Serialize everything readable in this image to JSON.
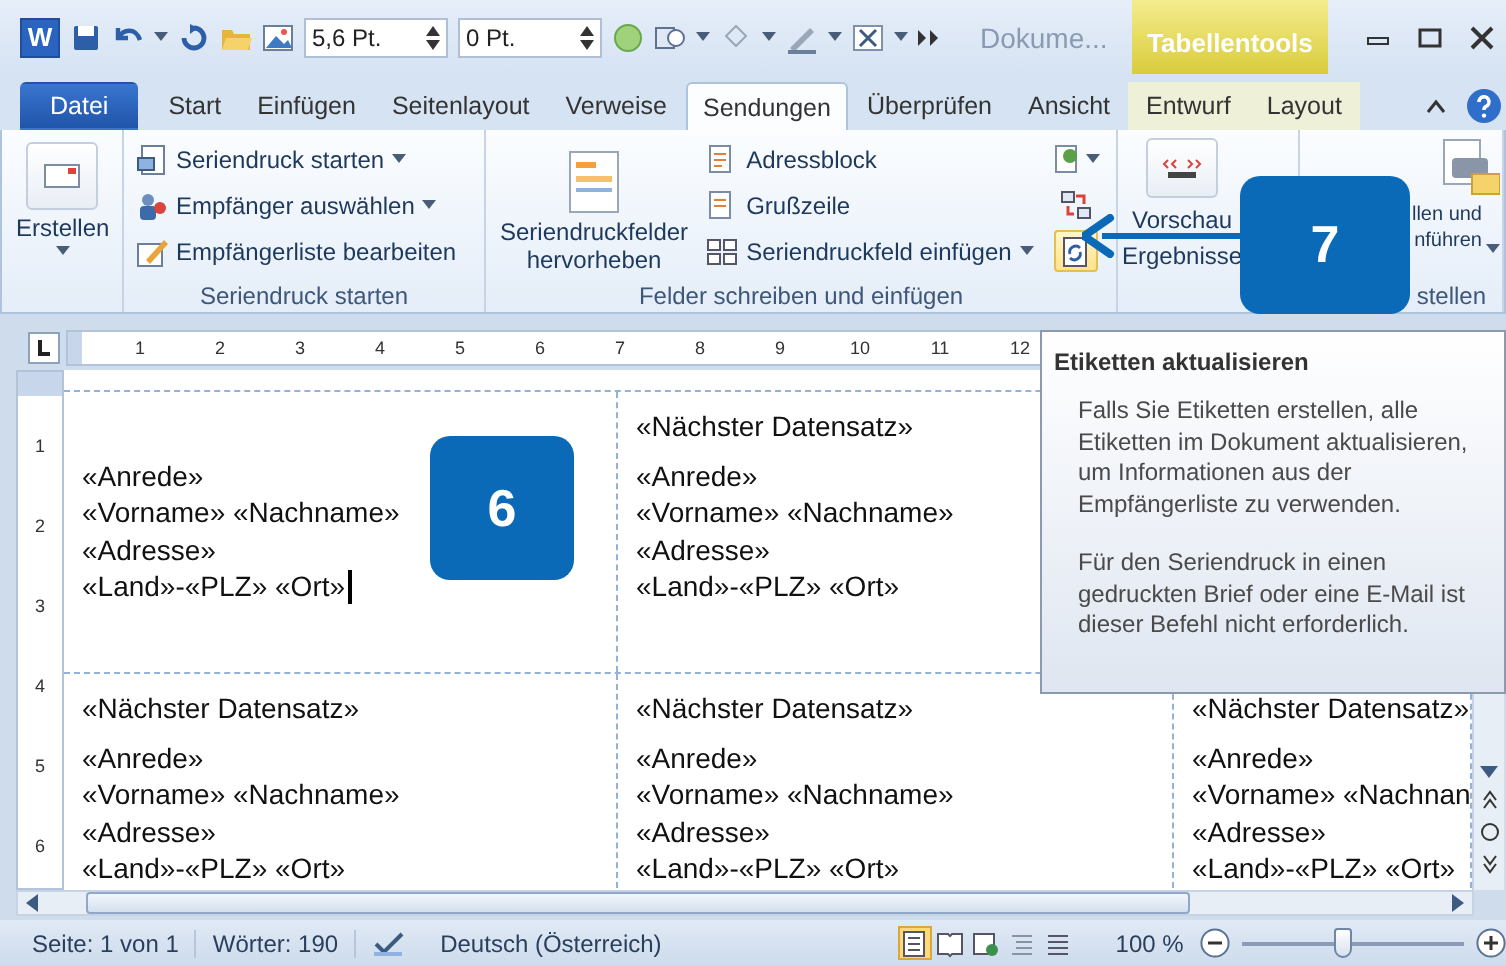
{
  "title_bar": {
    "app_letter": "W",
    "fields": [
      {
        "value": "5,6 Pt."
      },
      {
        "value": "0 Pt."
      }
    ],
    "document_title": "Dokume...",
    "context_title": "Tabellentools"
  },
  "tabs": [
    {
      "label": "Datei",
      "kind": "file",
      "selected": false
    },
    {
      "label": "Start",
      "kind": "normal",
      "selected": false
    },
    {
      "label": "Einfügen",
      "kind": "normal",
      "selected": false
    },
    {
      "label": "Seitenlayout",
      "kind": "normal",
      "selected": false
    },
    {
      "label": "Verweise",
      "kind": "normal",
      "selected": false
    },
    {
      "label": "Sendungen",
      "kind": "normal",
      "selected": true
    },
    {
      "label": "Überprüfen",
      "kind": "normal",
      "selected": false
    },
    {
      "label": "Ansicht",
      "kind": "normal",
      "selected": false
    },
    {
      "label": "Entwurf",
      "kind": "context",
      "selected": false
    },
    {
      "label": "Layout",
      "kind": "context",
      "selected": false
    }
  ],
  "ribbon": [
    {
      "kind": "create",
      "button": {
        "label": "Erstellen",
        "dropdown": true
      }
    },
    {
      "kind": "list",
      "label": "Seriendruck starten",
      "items": [
        {
          "label": "Seriendruck starten",
          "dropdown": true
        },
        {
          "label": "Empfänger auswählen",
          "dropdown": true
        },
        {
          "label": "Empfängerliste bearbeiten",
          "dropdown": false
        }
      ]
    },
    {
      "kind": "fields",
      "label": "Felder schreiben und einfügen",
      "big": {
        "label": "Seriendruckfelder\nhervorheben"
      },
      "items": [
        {
          "label": "Adressblock",
          "dropdown": false
        },
        {
          "label": "Grußzeile",
          "dropdown": false
        },
        {
          "label": "Seriendruckfeld einfügen",
          "dropdown": true
        }
      ],
      "tools": [
        {
          "dropdown": true,
          "highlighted": false
        },
        {
          "dropdown": false,
          "highlighted": false
        },
        {
          "dropdown": false,
          "highlighted": true
        }
      ]
    },
    {
      "kind": "preview",
      "big": {
        "label": "Vorschau\nErgebnisse"
      }
    },
    {
      "kind": "finish",
      "label": "stellen",
      "big": {
        "label": "llen und\nnführen",
        "dropdown": true
      }
    }
  ],
  "ruler": {
    "horizontal": [
      "1",
      "2",
      "3",
      "4",
      "5",
      "6",
      "7",
      "8",
      "9",
      "10",
      "11",
      "12"
    ],
    "vertical": [
      "1",
      "2",
      "3",
      "4",
      "5",
      "6"
    ]
  },
  "labels": [
    {
      "cells": [
        {
          "lines": [
            "«Anrede»",
            "«Vorname» «Nachname»",
            "«Adresse»",
            "«Land»-«PLZ» «Ort»"
          ],
          "caret": true
        },
        {
          "next_record": "«Nächster Datensatz»",
          "lines": [
            "«Anrede»",
            "«Vorname» «Nachname»",
            "«Adresse»",
            "«Land»-«PLZ» «Ort»"
          ],
          "caret": false
        }
      ]
    },
    {
      "cells": [
        {
          "next_record": "«Nächster Datensatz»",
          "lines": [
            "«Anrede»",
            "«Vorname» «Nachname»",
            "«Adresse»",
            "«Land»-«PLZ» «Ort»"
          ],
          "caret": false
        },
        {
          "next_record": "«Nächster Datensatz»",
          "lines": [
            "«Anrede»",
            "«Vorname» «Nachname»",
            "«Adresse»",
            "«Land»-«PLZ» «Ort»"
          ],
          "caret": false
        },
        {
          "next_record": "«Nächster Datensatz»",
          "lines": [
            "«Anrede»",
            "«Vorname» «Nachnan",
            "«Adresse»",
            "«Land»-«PLZ» «Ort»"
          ],
          "caret": false
        }
      ]
    }
  ],
  "tooltip": {
    "title": "Etiketten aktualisieren",
    "paragraphs": [
      "Falls Sie Etiketten erstellen, alle Etiketten im Dokument aktualisieren, um Informationen aus der Empfängerliste zu verwenden.",
      "Für den Seriendruck in einen gedruckten Brief oder eine E-Mail ist dieser Befehl nicht erforderlich."
    ]
  },
  "callouts": [
    "6",
    "7"
  ],
  "status_bar": {
    "page": "Seite: 1 von 1",
    "words": "Wörter: 190",
    "language": "Deutsch (Österreich)",
    "views": [
      {
        "selected": true
      },
      {
        "selected": false
      },
      {
        "selected": false
      },
      {
        "selected": false
      },
      {
        "selected": false
      }
    ],
    "zoom": "100 %",
    "zoom_slider": {
      "level": 0.45
    }
  }
}
